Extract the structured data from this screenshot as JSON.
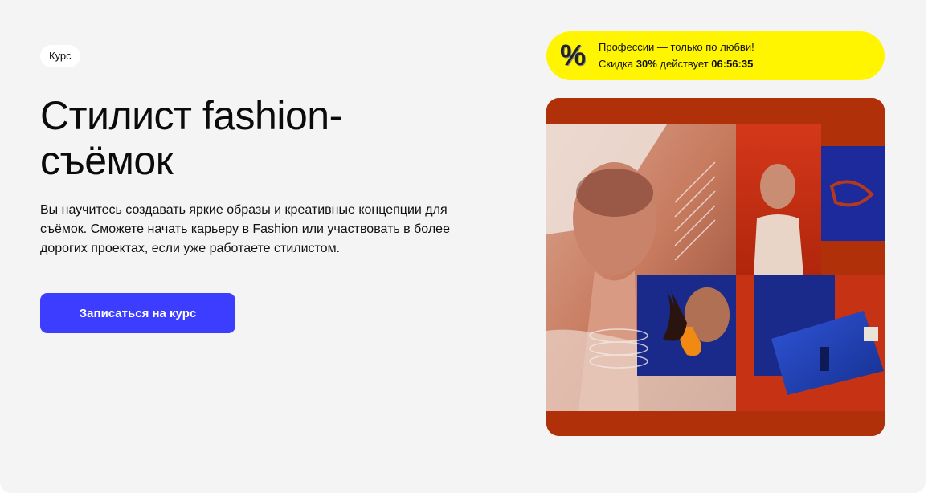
{
  "badge": {
    "label": "Курс"
  },
  "hero": {
    "title": "Стилист fashion-съёмок",
    "description": "Вы научитесь создавать яркие образы и креативные концепции для съёмок. Сможете начать карьеру в Fashion или участвовать в более дорогих проектах, если уже работаете стилистом.",
    "cta_label": "Записаться на курс"
  },
  "promo": {
    "icon": "percent-icon",
    "headline": "Профессии — только по любви!",
    "discount_prefix": "Скидка ",
    "discount_value": "30%",
    "discount_middle": " действует ",
    "timer": "06:56:35"
  },
  "colors": {
    "background": "#f4f4f4",
    "accent": "#3d3dff",
    "promo": "#fff500",
    "image_frame": "#b0300a"
  }
}
